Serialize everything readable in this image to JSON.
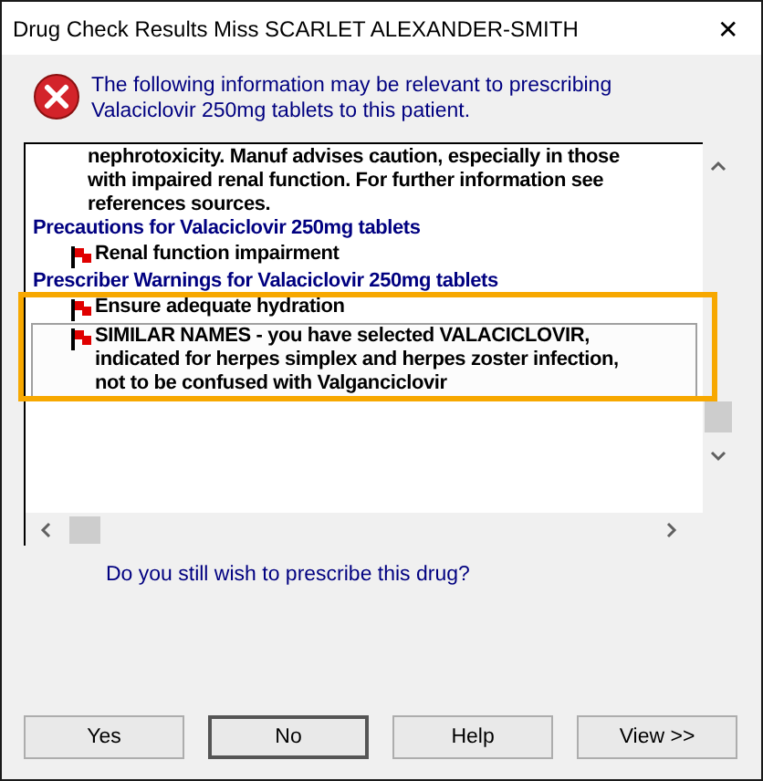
{
  "window": {
    "title": "Drug Check Results Miss SCARLET ALEXANDER-SMITH",
    "close": "✕"
  },
  "message": "The following information may be relevant to prescribing Valaciclovir 250mg tablets to this patient.",
  "results": [
    {
      "kind": "note",
      "lines": [
        "nephrotoxicity. Manuf advises caution, especially in those",
        "with impaired renal function. For further information see",
        "references sources."
      ]
    },
    {
      "kind": "heading",
      "lines": [
        "Precautions for Valaciclovir 250mg tablets"
      ]
    },
    {
      "kind": "warning",
      "lines": [
        "Renal function impairment"
      ],
      "selected": false
    },
    {
      "kind": "heading",
      "lines": [
        "Prescriber Warnings for Valaciclovir 250mg tablets"
      ]
    },
    {
      "kind": "warning",
      "lines": [
        "Ensure adequate hydration"
      ],
      "selected": false
    },
    {
      "kind": "warning",
      "lines": [
        "SIMILAR NAMES - you have selected VALACICLOVIR,",
        "indicated for herpes simplex and herpes zoster infection,",
        "not to be confused with Valganciclovir"
      ],
      "selected": true
    }
  ],
  "question": "Do you still wish to prescribe this drug?",
  "buttons": [
    {
      "label": "Yes",
      "default": false
    },
    {
      "label": "No",
      "default": true
    },
    {
      "label": "Help",
      "default": false
    },
    {
      "label": "View >>",
      "default": false
    }
  ]
}
